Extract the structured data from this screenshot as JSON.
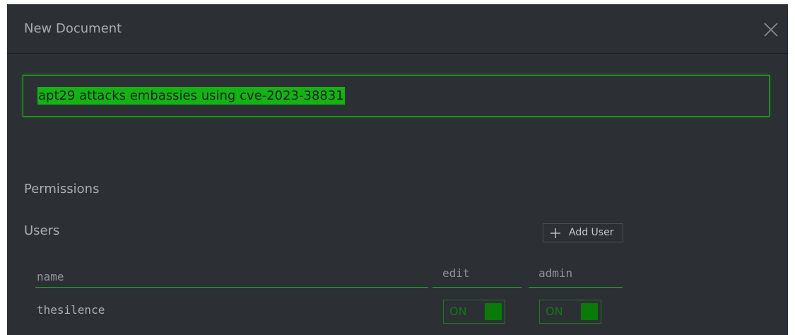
{
  "dialog": {
    "title": "New Document",
    "title_input_value": "apt29 attacks embassies using cve-2023-38831"
  },
  "permissions": {
    "heading": "Permissions",
    "users_heading": "Users",
    "add_user_label": "Add User",
    "columns": [
      "name",
      "edit",
      "admin"
    ],
    "rows": [
      {
        "name": "thesilence",
        "edit": "ON",
        "admin": "ON"
      }
    ]
  },
  "icons": {
    "close": "close-icon",
    "add": "plus-icon"
  },
  "colors": {
    "accent": "#1fb81f",
    "modal_background": "#2c3034",
    "selection": "#12b312"
  }
}
